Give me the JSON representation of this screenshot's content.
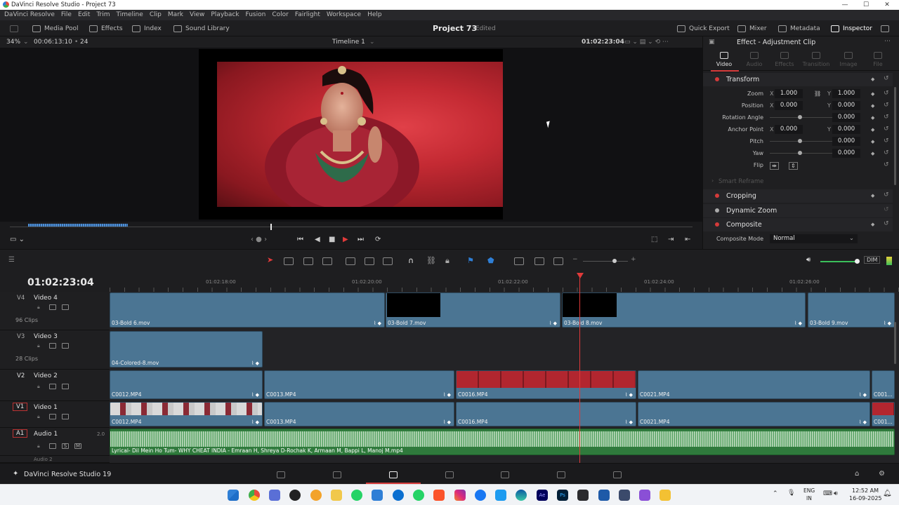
{
  "window": {
    "title": "DaVinci Resolve Studio - Project 73",
    "minimize": "—",
    "maximize": "☐",
    "close": "✕"
  },
  "menu": [
    "DaVinci Resolve",
    "File",
    "Edit",
    "Trim",
    "Timeline",
    "Clip",
    "Mark",
    "View",
    "Playback",
    "Fusion",
    "Color",
    "Fairlight",
    "Workspace",
    "Help"
  ],
  "toolbar": {
    "media_pool": "Media Pool",
    "effects": "Effects",
    "index": "Index",
    "sound_library": "Sound Library",
    "project": "Project 73",
    "status": "Edited",
    "quick_export": "Quick Export",
    "mixer": "Mixer",
    "metadata": "Metadata",
    "inspector": "Inspector"
  },
  "viewer": {
    "zoom": "34%",
    "duration": "00:06:13:10",
    "fps": "24",
    "timeline_name": "Timeline 1",
    "timecode": "01:02:23:04"
  },
  "inspector": {
    "title": "Effect - Adjustment Clip",
    "tabs": [
      "Video",
      "Audio",
      "Effects",
      "Transition",
      "Image",
      "File"
    ],
    "transform": {
      "name": "Transform",
      "zoom_label": "Zoom",
      "zoom_x": "1.000",
      "zoom_y": "1.000",
      "position_label": "Position",
      "position_x": "0.000",
      "position_y": "0.000",
      "rotation_label": "Rotation Angle",
      "rotation": "0.000",
      "anchor_label": "Anchor Point",
      "anchor_x": "0.000",
      "anchor_y": "0.000",
      "pitch_label": "Pitch",
      "pitch": "0.000",
      "yaw_label": "Yaw",
      "yaw": "0.000",
      "flip_label": "Flip",
      "x": "X",
      "y": "Y"
    },
    "smart_reframe": "Smart Reframe",
    "cropping": "Cropping",
    "dynamic_zoom": "Dynamic Zoom",
    "composite": "Composite",
    "composite_mode_label": "Composite Mode",
    "composite_mode": "Normal"
  },
  "timeline": {
    "timecode": "01:02:23:04",
    "ruler": [
      "01:02:18:00",
      "01:02:20:00",
      "01:02:22:00",
      "01:02:24:00",
      "01:02:26:00"
    ],
    "tracks": {
      "v4": {
        "id": "V4",
        "name": "Video 4",
        "clips": "96 Clips"
      },
      "v3": {
        "id": "V3",
        "name": "Video 3",
        "clips": "28 Clips"
      },
      "v2": {
        "id": "V2",
        "name": "Video 2"
      },
      "v1": {
        "id": "V1",
        "name": "Video 1"
      },
      "a1": {
        "id": "A1",
        "name": "Audio 1",
        "vol": "2.0",
        "s": "S",
        "m": "M"
      },
      "a2": {
        "name": "Audio 2"
      }
    },
    "v4_clips": [
      "03-Bold 6.mov",
      "03-Bold 7.mov",
      "03-Bold 8.mov",
      "03-Bold 9.mov"
    ],
    "v3_clips": [
      "04-Colored-8.mov"
    ],
    "v2_clips": [
      "C0012.MP4",
      "C0013.MP4",
      "C0016.MP4",
      "C0021.MP4",
      "C001..."
    ],
    "v1_clips": [
      "C0012.MP4",
      "C0013.MP4",
      "C0016.MP4",
      "C0021.MP4",
      "C001..."
    ],
    "a1_clip": "Lyrical- Dil Mein Ho Tum- WHY CHEAT INDIA - Emraan H, Shreya D-Rochak K, Armaan M, Bappi L, Manoj M.mp4",
    "dim": "DIM"
  },
  "pagenav": {
    "brand": "DaVinci Resolve Studio 19"
  },
  "taskbar": {
    "lang1": "ENG",
    "lang2": "IN",
    "time": "12:52 AM",
    "date": "16-09-2025"
  },
  "colors": {
    "accent": "#d43a3a",
    "clip": "#4b7593",
    "audio": "#2f7a3c"
  }
}
